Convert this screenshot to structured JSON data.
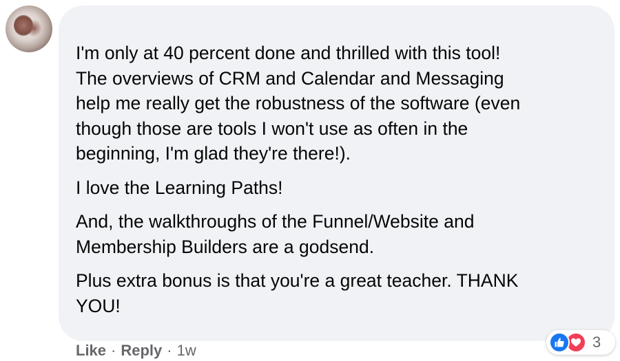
{
  "comment": {
    "paragraphs": [
      "I'm only at 40 percent done and thrilled with this tool!\nThe overviews of CRM and Calendar and Messaging\nhelp me really get the robustness of the software (even\nthough those are tools I won't use as often in the\nbeginning, I'm glad they're there!).",
      "I love the Learning Paths!",
      "And, the walkthroughs of the Funnel/Website and\nMembership Builders are a godsend.",
      "Plus extra bonus is that you're a great teacher. THANK\nYOU!"
    ]
  },
  "reactions": {
    "icons": [
      "like-icon",
      "love-icon"
    ],
    "count": "3",
    "colors": {
      "like": "#1877f2",
      "love": "#f33e58"
    }
  },
  "actions": {
    "like_label": "Like",
    "reply_label": "Reply",
    "separator": "·",
    "timestamp": "1w"
  },
  "theme": {
    "bubble_bg": "#f0f2f5",
    "text": "#050505",
    "secondary_text": "#65676b"
  }
}
